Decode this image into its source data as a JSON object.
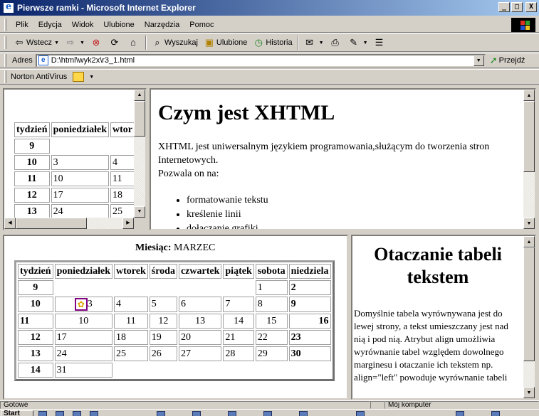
{
  "window": {
    "title": "Pierwsze ramki - Microsoft Internet Explorer",
    "btn_min": "_",
    "btn_max": "□",
    "btn_close": "X"
  },
  "menu": [
    "Plik",
    "Edycja",
    "Widok",
    "Ulubione",
    "Narzędzia",
    "Pomoc"
  ],
  "toolbar": {
    "back": "Wstecz",
    "search": "Wyszukaj",
    "favorites": "Ulubione",
    "history": "Historia"
  },
  "address": {
    "label": "Adres",
    "value": "D:\\html\\wyk2x\\r3_1.html",
    "go": "Przejdź"
  },
  "links": {
    "norton": "Norton AntiVirus"
  },
  "toc_frame": {
    "headers": [
      "tydzień",
      "poniedziałek",
      "wtor"
    ],
    "rows": [
      [
        "9",
        "",
        ""
      ],
      [
        "10",
        "3",
        "4"
      ],
      [
        "11",
        "10",
        "11"
      ],
      [
        "12",
        "17",
        "18"
      ],
      [
        "13",
        "24",
        "25"
      ]
    ]
  },
  "main_frame": {
    "heading": "Czym jest XHTML",
    "paragraph_1": "XHTML jest uniwersalnym językiem programowania,służącym do tworzenia stron Internetowych.",
    "paragraph_2": "Pozwala on na:",
    "list": [
      "formatowanie tekstu",
      "kreślenie linii",
      "dołączanie grafiki"
    ]
  },
  "calendar_frame": {
    "caption_bold": "Miesiąc:",
    "caption_value": "MARZEC",
    "headers": [
      "tydzień",
      "poniedziałek",
      "wtorek",
      "środa",
      "czwartek",
      "piątek",
      "sobota",
      "niedziela"
    ],
    "rows": [
      [
        "9",
        "",
        "",
        "",
        "",
        "",
        "1",
        "2"
      ],
      [
        "10",
        "3",
        "4",
        "5",
        "6",
        "7",
        "8",
        "9"
      ],
      [
        "11",
        "10",
        "11",
        "12",
        "13",
        "14",
        "15",
        "16"
      ],
      [
        "12",
        "17",
        "18",
        "19",
        "20",
        "21",
        "22",
        "23"
      ],
      [
        "13",
        "24",
        "25",
        "26",
        "27",
        "28",
        "29",
        "30"
      ],
      [
        "14",
        "31"
      ]
    ]
  },
  "text_frame": {
    "heading": "Otaczanie tabeli tekstem",
    "paragraph": "Domyślnie tabela wyrównywana jest do lewej strony, a tekst umieszczany jest nad nią i pod nią. Atrybut align umożliwia wyrównanie tabel względem dowolnego marginesu i otaczanie ich tekstem np. align=\"left\" powoduje wyrównanie tabeli"
  },
  "status": {
    "left": "Gotowe",
    "zone": "Mój komputer"
  },
  "taskbar": {
    "start": "Start"
  },
  "colors": {
    "titlebar_start": "#0a246a",
    "titlebar_end": "#a6caf0",
    "chrome": "#d4d0c8"
  }
}
